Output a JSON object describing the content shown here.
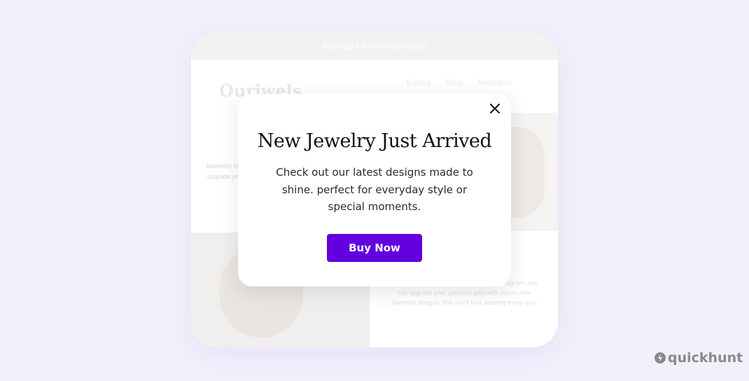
{
  "background_page": {
    "banner": "Sign up for our newsletter",
    "brand": "Ourjwels",
    "nav": [
      "Earing",
      "Ring",
      "Neckless"
    ],
    "left_text": "Jewellery locker! With upgrade your design",
    "bottom_text": "your locker! With Our's Gold Exchange Program, you can upgrade your precious gold with stylish new diamond designs, that you'll love wearing every day!"
  },
  "modal": {
    "title": "New Jewelry Just Arrived",
    "body": "Check out our latest designs made to shine. perfect for everyday style or special moments.",
    "button_label": "Buy Now",
    "close_icon": "close-icon"
  },
  "watermark": {
    "text": "quickhunt"
  },
  "colors": {
    "page_bg": "#f3f0fc",
    "button_bg": "#6200e0",
    "button_text": "#ffffff"
  }
}
